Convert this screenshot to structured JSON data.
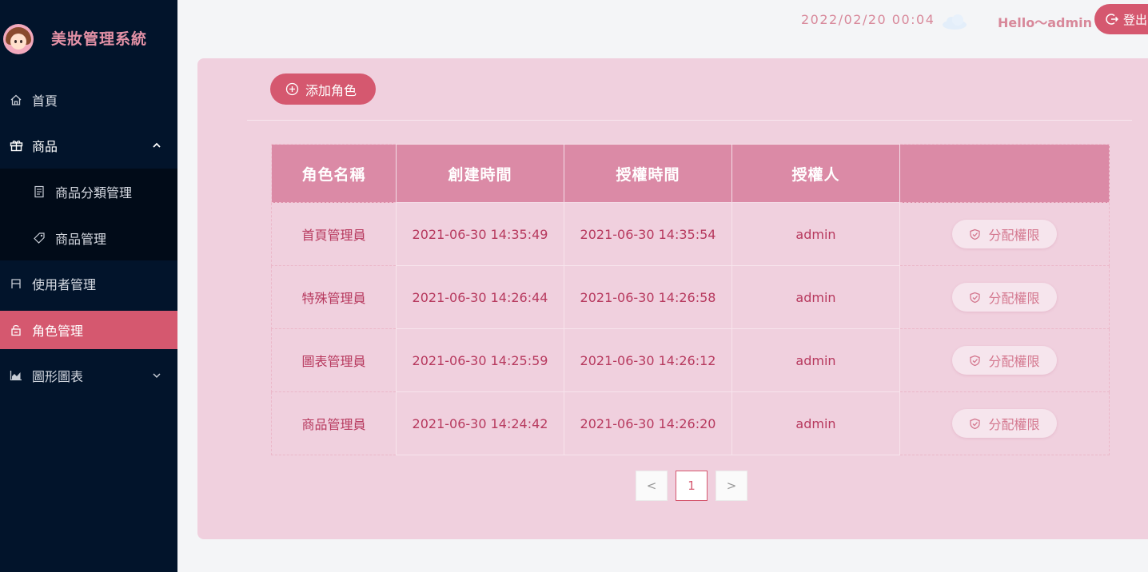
{
  "sidebar": {
    "brand_title": "美妝管理系統",
    "items": [
      {
        "label": "首頁",
        "icon": "home-icon"
      },
      {
        "label": "商品",
        "icon": "gift-icon",
        "expanded": true
      },
      {
        "label": "商品分類管理",
        "icon": "list-icon"
      },
      {
        "label": "商品管理",
        "icon": "tag-icon"
      },
      {
        "label": "使用者管理",
        "icon": "user-icon"
      },
      {
        "label": "角色管理",
        "icon": "lock-icon",
        "active": true
      },
      {
        "label": "圖形圖表",
        "icon": "chart-icon"
      }
    ]
  },
  "header": {
    "datetime": "2022/02/20 00:04",
    "weather_icon": "cloud-icon",
    "greeting": "Hello～admin",
    "logout_label": "登出"
  },
  "toolbar": {
    "add_role_label": "添加角色"
  },
  "table": {
    "headers": [
      "角色名稱",
      "創建時間",
      "授權時間",
      "授權人",
      ""
    ],
    "rows": [
      {
        "name": "首頁管理員",
        "created": "2021-06-30 14:35:49",
        "authorized": "2021-06-30 14:35:54",
        "authorizer": "admin",
        "action": "分配權限"
      },
      {
        "name": "特殊管理員",
        "created": "2021-06-30 14:26:44",
        "authorized": "2021-06-30 14:26:58",
        "authorizer": "admin",
        "action": "分配權限"
      },
      {
        "name": "圖表管理員",
        "created": "2021-06-30 14:25:59",
        "authorized": "2021-06-30 14:26:12",
        "authorizer": "admin",
        "action": "分配權限"
      },
      {
        "name": "商品管理員",
        "created": "2021-06-30 14:24:42",
        "authorized": "2021-06-30 14:26:20",
        "authorizer": "admin",
        "action": "分配權限"
      }
    ]
  },
  "pagination": {
    "prev": "<",
    "current": "1",
    "next": ">"
  },
  "colors": {
    "sidebar_bg": "#02142b",
    "accent": "#d5586f",
    "card_bg": "#f0d0de",
    "table_header_bg": "#db8aa6",
    "text_accent": "#b7395e"
  }
}
